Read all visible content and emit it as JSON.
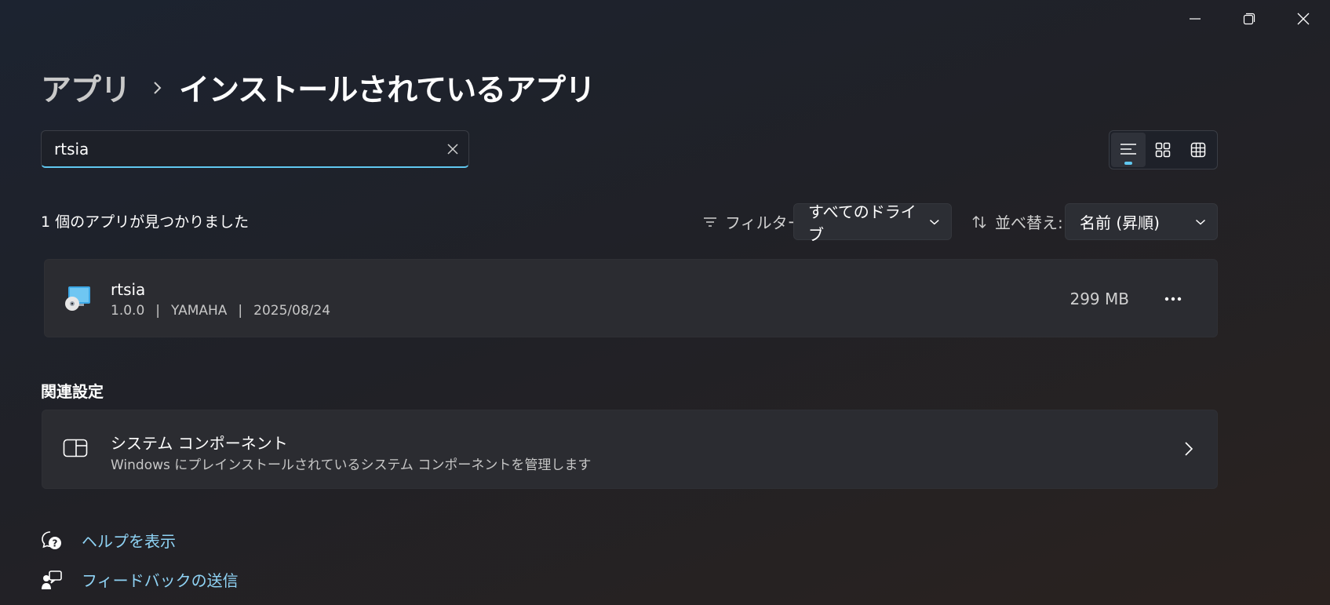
{
  "window": {
    "controls": {
      "minimize_icon": "minimize-icon",
      "maximize_icon": "restore-icon",
      "close_icon": "close-icon"
    }
  },
  "breadcrumb": {
    "parent": "アプリ",
    "separator_icon": "chevron-right-icon",
    "current": "インストールされているアプリ"
  },
  "search": {
    "value": "rtsia",
    "placeholder": "",
    "clear_icon": "close-icon"
  },
  "view_modes": [
    {
      "name": "list",
      "icon": "list-icon",
      "active": true
    },
    {
      "name": "grid",
      "icon": "grid-icon",
      "active": false
    },
    {
      "name": "tile",
      "icon": "table-icon",
      "active": false
    }
  ],
  "results": {
    "count_text": "1 個のアプリが見つかりました"
  },
  "filter": {
    "label": "フィルター:",
    "icon": "filter-icon",
    "selected": "すべてのドライブ"
  },
  "sort": {
    "label": "並べ替え:",
    "icon": "sort-icon",
    "selected": "名前 (昇順)"
  },
  "apps": [
    {
      "name": "rtsia",
      "version": "1.0.0",
      "separator": "|",
      "publisher": "YAMAHA",
      "date": "2025/08/24",
      "size": "299 MB",
      "icon": "installer-disc-icon",
      "more_icon": "more-icon"
    }
  ],
  "related": {
    "title": "関連設定",
    "system_components": {
      "title": "システム コンポーネント",
      "description": "Windows にプレインストールされているシステム コンポーネントを管理します",
      "icon": "system-components-icon"
    }
  },
  "links": {
    "help": {
      "label": "ヘルプを表示",
      "icon": "help-icon"
    },
    "feedback": {
      "label": "フィードバックの送信",
      "icon": "feedback-icon"
    }
  },
  "colors": {
    "accent": "#60c8f0",
    "link": "#8fd3f5"
  }
}
